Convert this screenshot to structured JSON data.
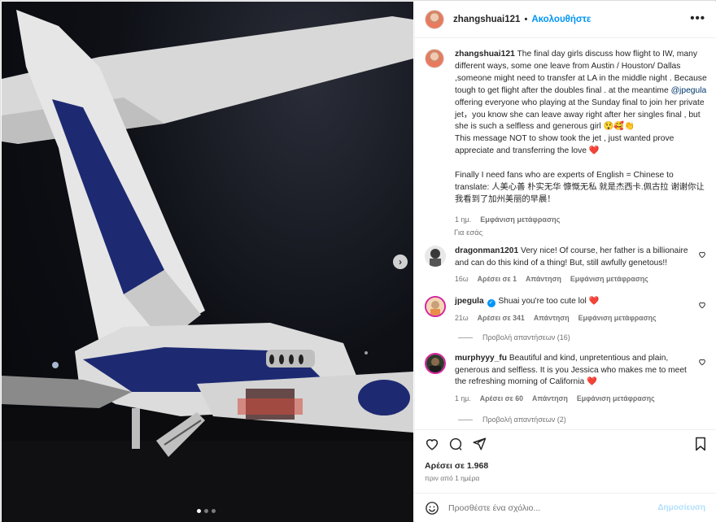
{
  "header": {
    "username": "zhangshuai121",
    "separator": "•",
    "follow_label": "Ακολουθήστε",
    "more_icon": "more-horizontal-icon"
  },
  "caption": {
    "username": "zhangshuai121",
    "text_part1": "The final day girls discuss how flight to IW, many different ways, some one leave from Austin / Houston/ Dallas ,someone might need to transfer at LA in the middle night . Because tough to get flight after the doubles final . at the meantime ",
    "mention": "@jpegula",
    "text_part2": " offering everyone who playing at the Sunday final to join her private jet，you know she can leave away right after her singles final , but she is such a selfless and generous girl 😲🥰👏",
    "text_line2": "This message NOT to show took the jet , just wanted prove appreciate and transferring the love ❤️",
    "text_line3": "Finally I need fans who are experts of English = Chinese to translate: 人美心善 朴实无华 慷慨无私 就是杰西卡.佩古拉 谢谢你让我看到了加州美丽的早晨！",
    "age": "1 ημ.",
    "translate_label": "Εμφάνιση μετάφρασης"
  },
  "for_you_label": "Για εσάς",
  "comments": [
    {
      "username": "dragonman1201",
      "text": "Very nice! Of course, her father is a billionaire and can do this kind of a thing! But, still awfully genetous!!",
      "age": "16ω",
      "likes": "Αρέσει σε 1",
      "reply_label": "Απάντηση",
      "translate_label": "Εμφάνιση μετάφρασης"
    },
    {
      "username": "jpegula",
      "text": "Shuai you're too cute lol ❤️",
      "age": "21ω",
      "likes": "Αρέσει σε 341",
      "reply_label": "Απάντηση",
      "translate_label": "Εμφάνιση μετάφρασης",
      "view_replies": "Προβολή απαντήσεων (16)"
    },
    {
      "username": "murphyyy_fu",
      "text": "Beautiful and kind, unpretentious and plain, generous and selfless. It is you Jessica who makes me to meet the refreshing morning of California ❤️",
      "age": "1 ημ.",
      "likes": "Αρέσει σε 60",
      "reply_label": "Απάντηση",
      "translate_label": "Εμφάνιση μετάφρασης",
      "view_replies": "Προβολή απαντήσεων (2)"
    }
  ],
  "actions": {
    "likes": "Αρέσει σε 1.968",
    "time": "πριν από 1 ημέρα"
  },
  "add_comment": {
    "placeholder": "Προσθέστε ένα σχόλιο...",
    "post_label": "Δημοσίευση"
  },
  "colors": {
    "accent": "#0095f6",
    "link": "#00376b",
    "secondary": "#737373",
    "heart": "#ed4956"
  }
}
